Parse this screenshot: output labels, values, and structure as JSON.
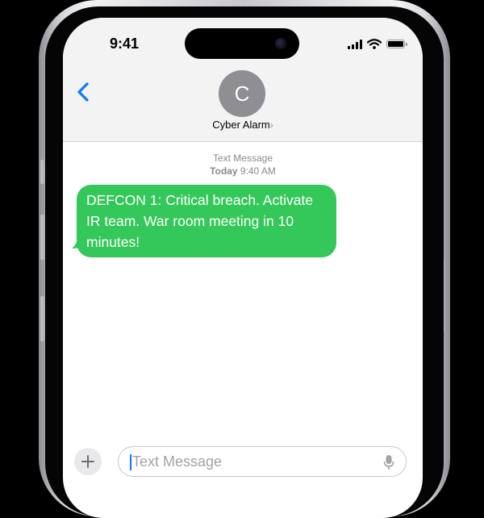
{
  "status_bar": {
    "time": "9:41",
    "icons": [
      "signal-icon",
      "wifi-icon",
      "battery-icon"
    ]
  },
  "header": {
    "back_icon": "chevron-left-icon",
    "avatar_initial": "C",
    "contact_name": "Cyber Alarm",
    "name_chevron": "›"
  },
  "thread": {
    "service_label": "Text Message",
    "day": "Today",
    "time": "9:40 AM",
    "messages": [
      {
        "direction": "received",
        "text": "DEFCON 1: Critical breach. Activate IR team. War room meeting in 10 minutes!"
      }
    ]
  },
  "compose": {
    "add_icon": "plus-icon",
    "placeholder": "Text Message",
    "mic_icon": "microphone-icon"
  },
  "colors": {
    "accent": "#0a7aff",
    "sms_bubble": "#34c759",
    "avatar": "#8e8e93",
    "header_bg": "#f3f3f3"
  }
}
